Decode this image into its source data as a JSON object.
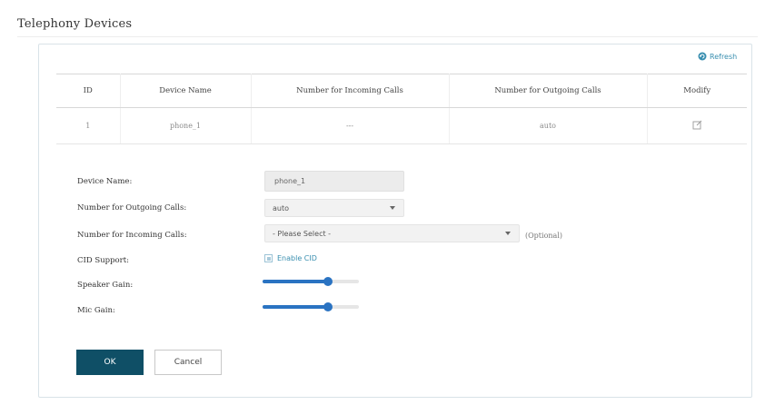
{
  "page": {
    "title": "Telephony Devices"
  },
  "toolbar": {
    "refresh_label": "Refresh",
    "refresh_icon": "refresh-icon",
    "accent_color": "#3a8fb0"
  },
  "table": {
    "headers": [
      "ID",
      "Device Name",
      "Number for Incoming Calls",
      "Number for Outgoing Calls",
      "Modify"
    ],
    "rows": [
      {
        "id": "1",
        "device_name": "phone_1",
        "incoming": "---",
        "outgoing": "auto",
        "modify_icon": "edit-icon"
      }
    ]
  },
  "form": {
    "device_name": {
      "label": "Device Name:",
      "value": "phone_1"
    },
    "outgoing": {
      "label": "Number for Outgoing Calls:",
      "value": "auto"
    },
    "incoming": {
      "label": "Number for Incoming Calls:",
      "placeholder": "- Please Select -",
      "hint": "(Optional)"
    },
    "cid": {
      "label": "CID Support:",
      "checkbox_label": "Enable CID",
      "checked": false
    },
    "speaker_gain": {
      "label": "Speaker Gain:",
      "level": 0.68
    },
    "mic_gain": {
      "label": "Mic Gain:",
      "level": 0.68
    },
    "ok_label": "OK",
    "cancel_label": "Cancel",
    "primary_color": "#0f4f66",
    "slider_color": "#2a73c2"
  }
}
